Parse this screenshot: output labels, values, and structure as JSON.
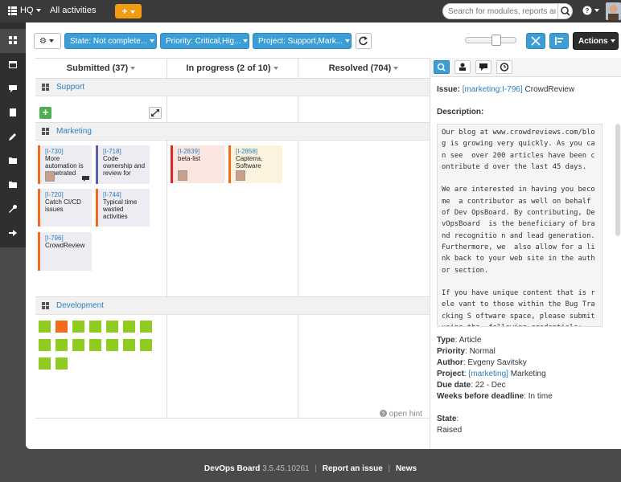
{
  "topbar": {
    "org": "HQ",
    "context": "All activities",
    "add_label": "+",
    "search_placeholder": "Search for modules, reports and"
  },
  "toolbar": {
    "settings_label": "⚙",
    "filters": [
      {
        "label": "State: Not complete..."
      },
      {
        "label": "Priority: Critical,Hig..."
      },
      {
        "label": "Project: Support,Mark..."
      }
    ],
    "actions_label": "Actions"
  },
  "columns": [
    {
      "label": "Submitted (37)"
    },
    {
      "label": "In progress (2 of 10)"
    },
    {
      "label": "Resolved (704)"
    }
  ],
  "swimlanes": [
    {
      "label": "Support"
    },
    {
      "label": "Marketing"
    },
    {
      "label": "Development"
    }
  ],
  "cards": [
    {
      "id": "[I-730]",
      "title": "More automation is penetrated",
      "color": "#f26a1b"
    },
    {
      "id": "[I-718]",
      "title": "Code ownership and review for",
      "color": "#5a5fa8"
    },
    {
      "id": "[I-720]",
      "title": "Catch CI/CD issues",
      "color": "#f26a1b"
    },
    {
      "id": "[I-744]",
      "title": "Typical time wasted activities",
      "color": "#f26a1b"
    },
    {
      "id": "[I-796]",
      "title": "CrowdReview",
      "color": "#f26a1b"
    },
    {
      "id": "[I-2839]",
      "title": "beta-list",
      "color": "#e02727"
    },
    {
      "id": "[I-2858]",
      "title": "Capterra, Software",
      "color": "#f26a1b"
    }
  ],
  "open_hint": "open hint",
  "detail": {
    "issue_label": "Issue:",
    "issue_id": "[marketing:I-796]",
    "issue_title": "CrowdReview",
    "description_label": "Description:",
    "description_text": "Our blog at www.crowdreviews.com/blog is growing very quickly. As you can see  over 200 articles have been contribute d over the last 45 days.\n\nWe are interested in having you become  a contributor as well on behalf of Dev OpsBoard. By contributing, DevOpsBoard  is the beneficiary of brand recognitio n and lead generation. Furthermore, we  also allow for a link back to your web site in the author section.\n\nIf you have unique content that is rele vant to those within the Bug Tracking S oftware space, please submit using the  following credentials:",
    "type_label": "Type",
    "type_value": "Article",
    "priority_label": "Priority",
    "priority_value": "Normal",
    "author_label": "Author",
    "author_value": "Evgeny Savitsky",
    "project_label": "Project",
    "project_link": "[marketing]",
    "project_value": "Marketing",
    "due_label": "Due date",
    "due_value": "22 - Dec",
    "weeks_label": "Weeks before deadline",
    "weeks_value": "In time",
    "state_label": "State",
    "state_value": "Raised"
  },
  "footer": {
    "product": "DevOps Board",
    "version": "3.5.45.10261",
    "report": "Report an issue",
    "separator": "|",
    "news": "News"
  },
  "colors": {
    "accent": "#3c9ed6",
    "add_button": "#f39c12",
    "dev_tile": "#8fcc1f",
    "dev_tile_highlight": "#f26a1b"
  }
}
